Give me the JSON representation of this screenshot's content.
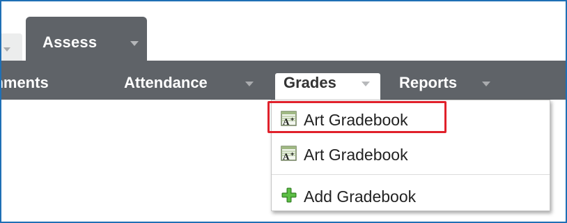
{
  "tabs": {
    "assess_label": "Assess"
  },
  "menubar": {
    "items": [
      {
        "label": "gnments"
      },
      {
        "label": "Attendance"
      },
      {
        "label": "Grades"
      },
      {
        "label": "Reports"
      }
    ]
  },
  "dropdown": {
    "items": [
      {
        "label": "Art Gradebook",
        "icon": "gradebook-icon"
      },
      {
        "label": "Art Gradebook",
        "icon": "gradebook-icon"
      },
      {
        "label": "Add Gradebook",
        "icon": "green-plus-icon"
      }
    ]
  },
  "colors": {
    "menubar": "#5f6368",
    "highlight": "#e0212b",
    "frame": "#1f6fb5"
  }
}
